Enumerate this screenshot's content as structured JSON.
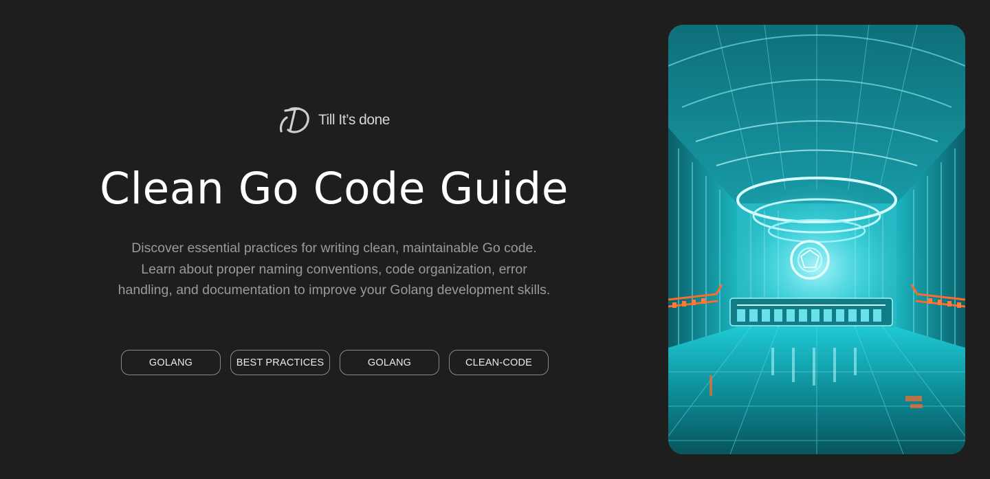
{
  "brand": {
    "name": "Till It’s done",
    "logo_icon": "till-its-done-logo-icon"
  },
  "hero": {
    "title": "Clean Go Code Guide",
    "description_lines": [
      "Discover essential practices for writing clean, maintainable Go code.",
      "Learn about proper naming conventions, code organization, error",
      "handling, and documentation to improve your Golang development skills."
    ]
  },
  "tags": [
    "GOLANG",
    "BEST PRACTICES",
    "GOLANG",
    "CLEAN-CODE"
  ],
  "image": {
    "alt": "Futuristic neon-lit teal hall with glowing orange lights",
    "accent_colors": [
      "#1fd4e0",
      "#ff6a2a",
      "#0b5d66"
    ]
  },
  "colors": {
    "background": "#1e1e1e",
    "title": "#ffffff",
    "description": "#9a9a9a",
    "tag_border": "#8a8a8a"
  }
}
